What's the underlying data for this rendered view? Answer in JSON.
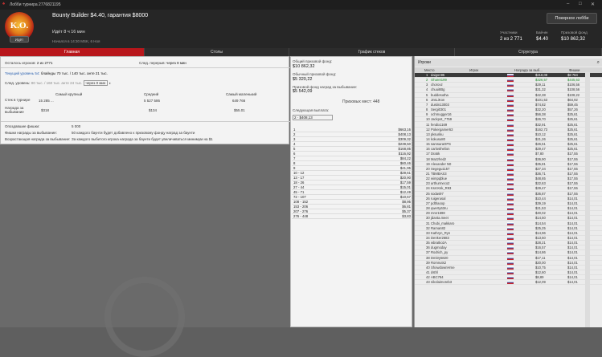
{
  "window": {
    "title": "Лобби турнира 2776821195",
    "min": "–",
    "max": "□",
    "close": "✕"
  },
  "header": {
    "logo_text": "K.O.",
    "logo_badge": "Идёт",
    "title": "Bounty Builder $4.40, гарантия $8000",
    "time": "Идёт 8 ч 16 мин",
    "start": "Начался в 14:30 MSK, 6 Ноя",
    "lobby_button": "Покерное лобби",
    "participants_label": "Участники",
    "participants": "2 из 2 771",
    "buyin_label": "Бай-ин",
    "buyin": "$4.40",
    "prize_label": "Призовой фонд",
    "prize": "$10 862,32"
  },
  "tabs": [
    "Главная",
    "Столы",
    "График стеков",
    "Структура"
  ],
  "main": {
    "players_left_label": "Осталось игроков:",
    "players_left": "2 из 2771",
    "next_break_label": "След. перерыв:",
    "next_break": "через 8 мин",
    "level_label": "Текущий уровень 54:",
    "level": "блайнды 70 тыс. / 140 тыс. анте 21 тыс.",
    "next_level_label": "След. уровень:",
    "next_level": "80 тыс. / 160 тыс. анте 24 тыс.",
    "next_level_time": "через 0 мин",
    "stack_headers": [
      "Самый крупный",
      "Средний",
      "Самый маленький"
    ],
    "stack_label": "Стек в турнире",
    "stacks": [
      "15 285 ...",
      "5 527 586",
      "649 766"
    ],
    "bounty_label": "Награда за выбывание",
    "bounties": [
      "$318",
      "$134",
      "$55.01"
    ],
    "late_label": "Опоздавшие фишки:",
    "late": "5 000",
    "pct_label": "Фишки награды за выбывание:",
    "pct": "50 каждого баунти будет добавлено к призовому фонду наград за баунти",
    "prog_label": "Возрастающая награда за выбывание:",
    "prog": "За каждого выбитого игрока награда за баунти будет увеличиваться минимум на $1"
  },
  "prizes": {
    "pool_label": "Общий призовой фонд:",
    "pool": "$10 862,32",
    "regular_label": "Обычный призовой фонд:",
    "regular": "$5 320,22",
    "bounty_label": "Призовой фонд наград за выбывание:",
    "bounty": "$5 542,09",
    "places": "Призовых мест: 448",
    "next_label": "Следующая выплата:",
    "next": "2 · $408,13",
    "rows": [
      [
        "1",
        "$663,16"
      ],
      [
        "2",
        "$408,13"
      ],
      [
        "3",
        "$309,32"
      ],
      [
        "4",
        "$239,50"
      ],
      [
        "5",
        "$168,85"
      ],
      [
        "6",
        "$116,92"
      ],
      [
        "7",
        "$84,22"
      ],
      [
        "8",
        "$60,46"
      ],
      [
        "9",
        "$41,95"
      ],
      [
        "10 - 12",
        "$29,61"
      ],
      [
        "13 - 17",
        "$20,90"
      ],
      [
        "18 - 26",
        "$17,59"
      ],
      [
        "27 - 44",
        "$15,01"
      ],
      [
        "45 - 71",
        "$12,49"
      ],
      [
        "72 - 107",
        "$10,67"
      ],
      [
        "108 - 152",
        "$8,95"
      ],
      [
        "153 - 206",
        "$6,81"
      ],
      [
        "207 - 276",
        "$5,37"
      ],
      [
        "276 - 448",
        "$3,83"
      ]
    ]
  },
  "players": {
    "title": "Игроки",
    "cols": [
      "Место",
      "Игрок",
      "Награда за выб...",
      "Фишки"
    ],
    "rows": [
      [
        "1",
        "daigon95",
        "$218,08",
        "$8 784"
      ],
      [
        "2",
        "Oharet199",
        "$326,57",
        "$445,63"
      ],
      [
        "3",
        "chorovz",
        "$29,11",
        "$106,56"
      ],
      [
        "4",
        "chuui8Bg",
        "$31,32",
        "$108,56"
      ],
      [
        "5",
        "buddesutha",
        "$42,38",
        "$108,22"
      ],
      [
        "6",
        "JnsLiKon",
        "$101,53",
        "$64,92"
      ],
      [
        "7",
        "dustin13003",
        "$74,82",
        "$59,45"
      ],
      [
        "8",
        "Sergi0301",
        "$32,20",
        "$57,26"
      ],
      [
        "9",
        "ochmugger16",
        "$56,38",
        "$25,61"
      ],
      [
        "10",
        "Jackpot_7759",
        "$26,70",
        "$25,61"
      ],
      [
        "11",
        "fendix1169",
        "$32,91",
        "$25,61"
      ],
      [
        "12",
        "Pokergamer63",
        "$162,73",
        "$25,61"
      ],
      [
        "13",
        "pksuriku",
        "$10,12",
        "$25,61"
      ],
      [
        "14",
        "kokusu80",
        "$21,26",
        "$25,61"
      ],
      [
        "15",
        "samsaraOPS",
        "$26,51",
        "$25,61"
      ],
      [
        "16",
        "carlosthelion",
        "$29,47",
        "$25,61"
      ],
      [
        "17",
        "Dra5k",
        "$7,80",
        "$17,55"
      ],
      [
        "18",
        "Mazzhedz",
        "$36,90",
        "$17,55"
      ],
      [
        "19",
        "Alexander N0",
        "$35,81",
        "$17,55"
      ],
      [
        "20",
        "Segegu1157",
        "$27,34",
        "$17,55"
      ],
      [
        "21",
        "TBMBAS3",
        "$36,71",
        "$17,55"
      ],
      [
        "22",
        "wimpqblue",
        "$48,65",
        "$17,55"
      ],
      [
        "23",
        "arthurmeco2",
        "$22,63",
        "$17,55"
      ],
      [
        "24",
        "KsrcKsk_R93",
        "$29,47",
        "$17,55"
      ],
      [
        "25",
        "sodas97",
        "$36,87",
        "$17,55"
      ],
      [
        "26",
        "ruigerusal",
        "$10,44",
        "$14,01"
      ],
      [
        "27",
        "pdthaoop",
        "$39,19",
        "$14,01"
      ],
      [
        "28",
        "qwerty63ru",
        "$21,53",
        "$14,01"
      ],
      [
        "29",
        "mrxr1698",
        "$40,02",
        "$14,01"
      ],
      [
        "30",
        "jdanta.meet",
        "$14,50",
        "$14,01"
      ],
      [
        "31",
        "Chubi_makkaro",
        "$14,54",
        "$14,01"
      ],
      [
        "32",
        "Raman82",
        "$25,25",
        "$14,01"
      ],
      [
        "33",
        "Kathryn_Ryn",
        "$14,96",
        "$14,01"
      ],
      [
        "34",
        "Denker2683",
        "$13,50",
        "$14,01"
      ],
      [
        "35",
        "wbratko2A",
        "$28,21",
        "$14,01"
      ],
      [
        "36",
        "dugmoday",
        "$16,57",
        "$14,01"
      ],
      [
        "37",
        "Rodrich_py",
        "$14,86",
        "$14,01"
      ],
      [
        "38",
        "Dmitry5820",
        "$17,11",
        "$14,01"
      ],
      [
        "39",
        "Romnuts2",
        "$20,00",
        "$14,01"
      ],
      [
        "40",
        "ShowdownHrne",
        "$10,75",
        "$14,01"
      ],
      [
        "41",
        "dsthl",
        "$12,60",
        "$14,01"
      ],
      [
        "42",
        "ABC784",
        "$8,89",
        "$14,01"
      ],
      [
        "43",
        "nikolaimoreb3",
        "$12,09",
        "$14,01"
      ]
    ]
  }
}
